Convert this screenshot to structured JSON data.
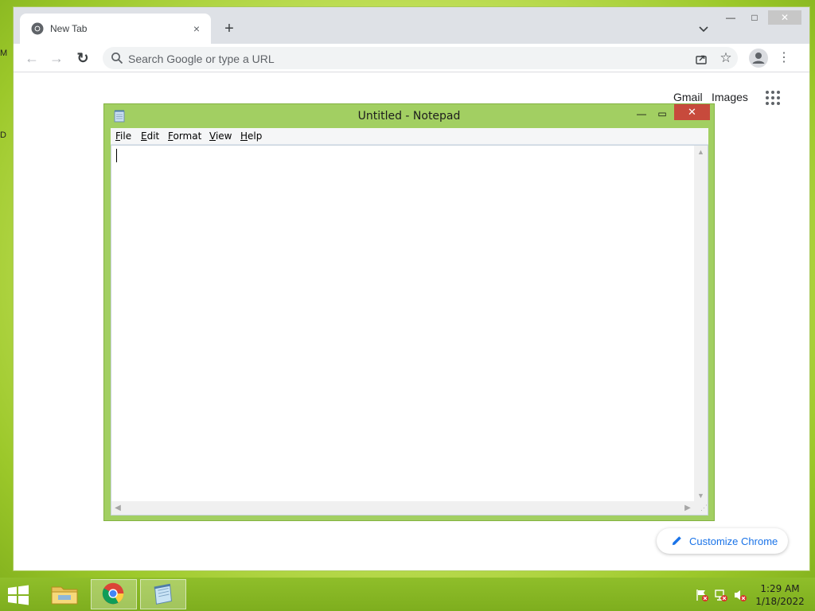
{
  "desktop": {
    "fragments": [
      "M",
      "D"
    ]
  },
  "browser": {
    "tab": {
      "title": "New Tab",
      "close_icon": "×"
    },
    "new_tab_icon": "+",
    "window_controls": {
      "minimize": "—",
      "maximize": "□",
      "close": "✕"
    },
    "toolbar": {
      "back_icon": "←",
      "forward_icon": "→",
      "reload_icon": "↻",
      "omnibox_placeholder": "Search Google or type a URL",
      "star_icon": "☆",
      "menu_icon": "⋮"
    },
    "ntp": {
      "gmail_label": "Gmail",
      "images_label": "Images",
      "customize_label": "Customize Chrome"
    }
  },
  "notepad": {
    "title": "Untitled - Notepad",
    "controls": {
      "minimize": "—",
      "maximize": "▭",
      "close": "✕"
    },
    "menu": [
      "File",
      "Edit",
      "Format",
      "View",
      "Help"
    ],
    "content": "",
    "scroll_arrows": {
      "up": "▲",
      "down": "▼",
      "left": "◀",
      "right": "▶",
      "grip": "⋰"
    }
  },
  "taskbar": {
    "clock": {
      "time": "1:29 AM",
      "date": "1/18/2022"
    }
  },
  "colors": {
    "notepad_frame": "#a2cf62",
    "notepad_close": "#c74a3c",
    "link_blue": "#1a73e8",
    "taskbar": "#8fbe2a"
  }
}
